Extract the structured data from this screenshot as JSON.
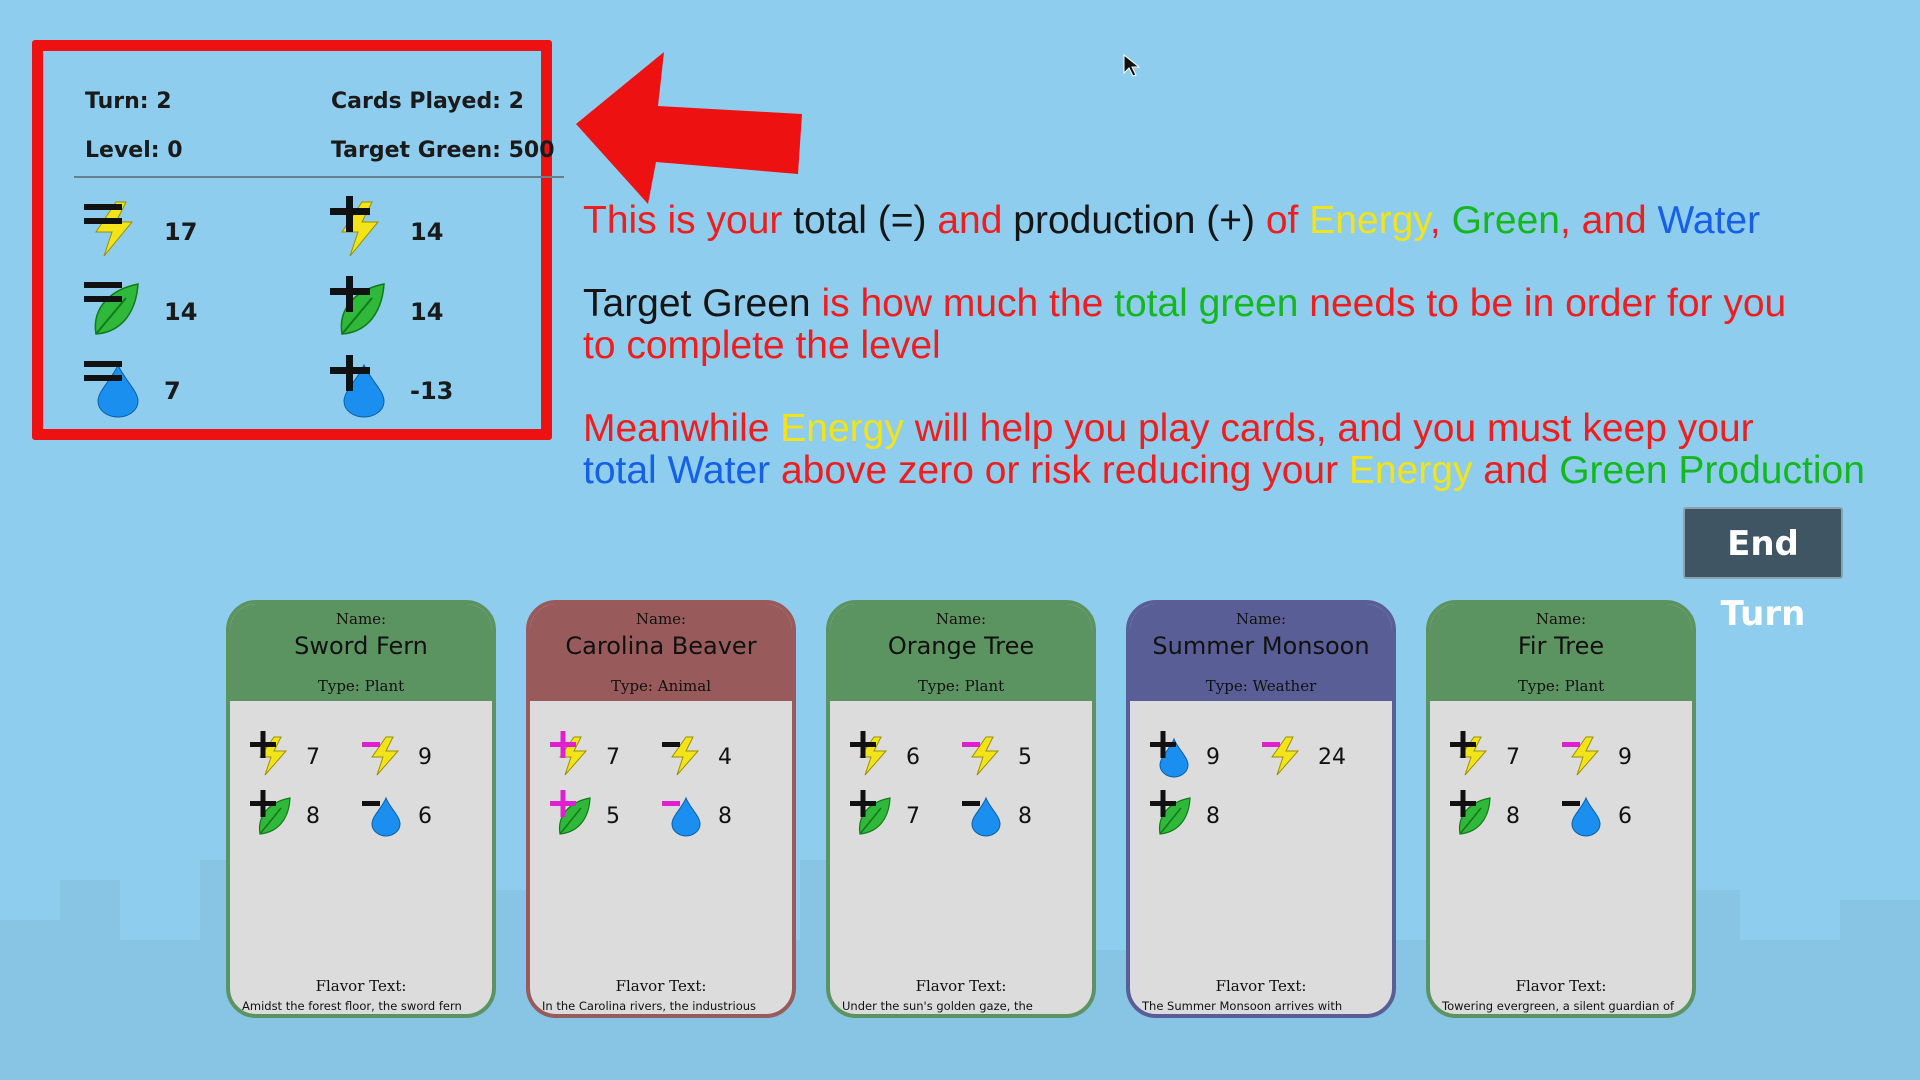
{
  "stats": {
    "turn_label": "Turn: 2",
    "cards_played_label": "Cards Played: 2",
    "level_label": "Level: 0",
    "target_green_label": "Target Green: 500",
    "total_energy": "17",
    "prod_energy": "14",
    "total_green": "14",
    "prod_green": "14",
    "total_water": "7",
    "prod_water": "-13"
  },
  "instructions": {
    "line1": [
      {
        "t": "This is your ",
        "c": "red"
      },
      {
        "t": "total (=) ",
        "c": "black"
      },
      {
        "t": "and ",
        "c": "red"
      },
      {
        "t": "production (+) ",
        "c": "black"
      },
      {
        "t": "of ",
        "c": "red"
      },
      {
        "t": "Energy",
        "c": "yellow"
      },
      {
        "t": ", ",
        "c": "red"
      },
      {
        "t": "Green",
        "c": "green"
      },
      {
        "t": ", and ",
        "c": "red"
      },
      {
        "t": "Water",
        "c": "blue"
      }
    ],
    "line2": [
      {
        "t": "Target Green ",
        "c": "black"
      },
      {
        "t": "is how much the ",
        "c": "red"
      },
      {
        "t": "total green ",
        "c": "green"
      },
      {
        "t": "needs to be in order for you",
        "c": "red"
      }
    ],
    "line3": [
      {
        "t": "to complete the level",
        "c": "red"
      }
    ],
    "line4": [
      {
        "t": "Meanwhile ",
        "c": "red"
      },
      {
        "t": "Energy ",
        "c": "yellow"
      },
      {
        "t": "will help you play cards, and you must keep your",
        "c": "red"
      }
    ],
    "line5": [
      {
        "t": "total Water ",
        "c": "blue"
      },
      {
        "t": "above zero or risk reducing your ",
        "c": "red"
      },
      {
        "t": "Energy ",
        "c": "yellow"
      },
      {
        "t": "and ",
        "c": "red"
      },
      {
        "t": "Green Production",
        "c": "green"
      }
    ]
  },
  "end_turn_label": "End Turn",
  "colors": {
    "red": "#ee1e1e",
    "black": "#151515",
    "yellow": "#f2e419",
    "green": "#14b81e",
    "blue": "#1560e6",
    "magenta": "#e020d0"
  },
  "cards": [
    {
      "name_label": "Name:",
      "name": "Sword Fern",
      "type": "Type: Plant",
      "header_color": "#5c9461",
      "border_color": "#5c9461",
      "stats": [
        {
          "sign": "plus",
          "sign_color": "#111111",
          "icon": "energy-icon",
          "value": "7"
        },
        {
          "sign": "minus",
          "sign_color": "#e020d0",
          "icon": "energy-icon",
          "value": "9"
        },
        {
          "sign": "plus",
          "sign_color": "#111111",
          "icon": "leaf-icon",
          "value": "8"
        },
        {
          "sign": "minus",
          "sign_color": "#111111",
          "icon": "water-icon",
          "value": "6"
        }
      ],
      "flavor_label": "Flavor Text:",
      "flavor": "Amidst the forest floor, the sword fern stands as a resilient sentinel, its vibrant fronds slicing through the dappled sunlight."
    },
    {
      "name_label": "Name:",
      "name": "Carolina Beaver",
      "type": "Type: Animal",
      "header_color": "#985a5a",
      "border_color": "#985a5a",
      "stats": [
        {
          "sign": "plus",
          "sign_color": "#e020d0",
          "icon": "energy-icon",
          "value": "7"
        },
        {
          "sign": "minus",
          "sign_color": "#111111",
          "icon": "energy-icon",
          "value": "4"
        },
        {
          "sign": "plus",
          "sign_color": "#e020d0",
          "icon": "leaf-icon",
          "value": "5"
        },
        {
          "sign": "minus",
          "sign_color": "#e020d0",
          "icon": "water-icon",
          "value": "8"
        }
      ],
      "flavor_label": "Flavor Text:",
      "flavor": "In the Carolina rivers, the industrious beaver shapes its watery domain, weaving a tapestry of life with deft skill and determination."
    },
    {
      "name_label": "Name:",
      "name": "Orange Tree",
      "type": "Type: Plant",
      "header_color": "#5c9461",
      "border_color": "#5c9461",
      "stats": [
        {
          "sign": "plus",
          "sign_color": "#111111",
          "icon": "energy-icon",
          "value": "6"
        },
        {
          "sign": "minus",
          "sign_color": "#e020d0",
          "icon": "energy-icon",
          "value": "5"
        },
        {
          "sign": "plus",
          "sign_color": "#111111",
          "icon": "leaf-icon",
          "value": "7"
        },
        {
          "sign": "minus",
          "sign_color": "#111111",
          "icon": "water-icon",
          "value": "8"
        }
      ],
      "flavor_label": "Flavor Text:",
      "flavor": "Under the sun's golden gaze, the Orange Tree bears the fruits of summer, a symbol of vitality and abundance in the orchard."
    },
    {
      "name_label": "Name:",
      "name": "Summer Monsoon",
      "type": "Type: Weather",
      "header_color": "#5a5e96",
      "border_color": "#5a5e96",
      "stats": [
        {
          "sign": "plus",
          "sign_color": "#111111",
          "icon": "water-icon",
          "value": "9"
        },
        {
          "sign": "minus",
          "sign_color": "#e020d0",
          "icon": "energy-icon",
          "value": "24"
        },
        {
          "sign": "plus",
          "sign_color": "#111111",
          "icon": "leaf-icon",
          "value": "8"
        }
      ],
      "flavor_label": "Flavor Text:",
      "flavor": "The Summer Monsoon arrives with thunderous applause, quenching the thirst of the land, and painting it in vibrant hues of green."
    },
    {
      "name_label": "Name:",
      "name": "Fir Tree",
      "type": "Type: Plant",
      "header_color": "#5c9461",
      "border_color": "#5c9461",
      "stats": [
        {
          "sign": "plus",
          "sign_color": "#111111",
          "icon": "energy-icon",
          "value": "7"
        },
        {
          "sign": "minus",
          "sign_color": "#e020d0",
          "icon": "energy-icon",
          "value": "9"
        },
        {
          "sign": "plus",
          "sign_color": "#111111",
          "icon": "leaf-icon",
          "value": "8"
        },
        {
          "sign": "minus",
          "sign_color": "#111111",
          "icon": "water-icon",
          "value": "6"
        }
      ],
      "flavor_label": "Flavor Text:",
      "flavor": "Towering evergreen, a silent guardian of the forest, drinking from hidden springs, basking in the sun's embrace."
    }
  ]
}
